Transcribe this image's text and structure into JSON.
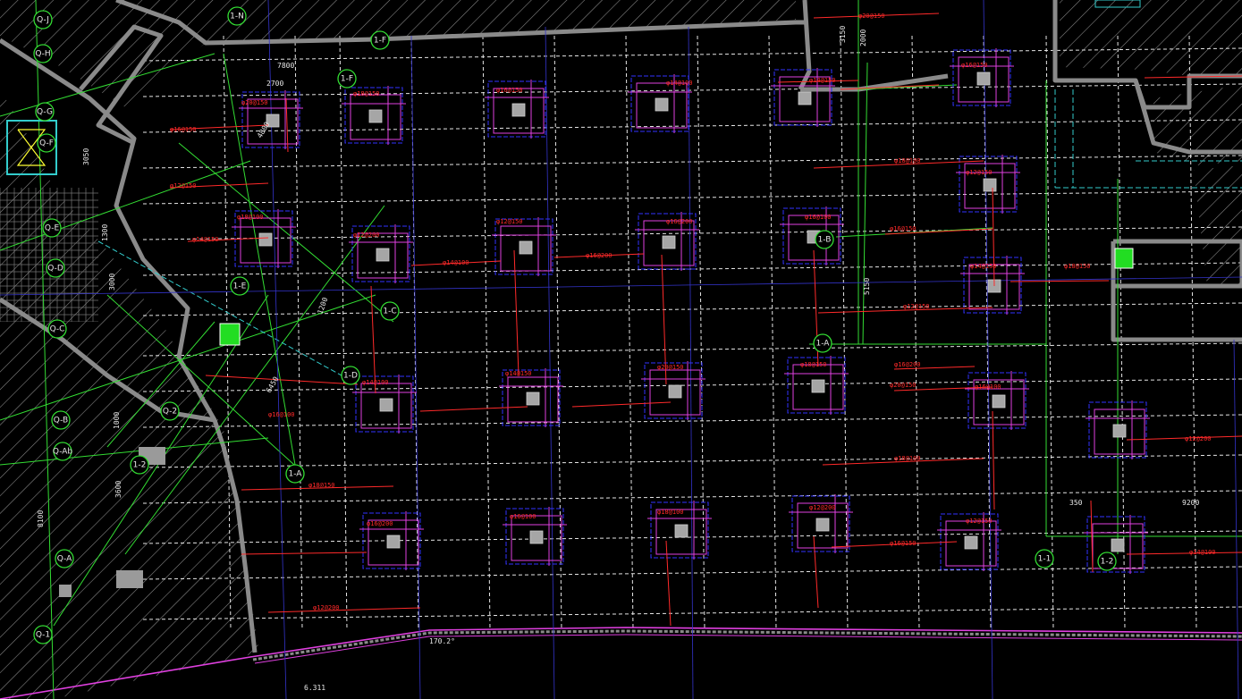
{
  "colors": {
    "background": "#000000",
    "grid": "#e6e6e6",
    "wall": "#8a8a8a",
    "hatch": "#9a9a9a",
    "red_rebar": "#ff2a2a",
    "magenta": "#e040e0",
    "blue": "#3232ff",
    "green": "#33dd33",
    "cyan": "#33cccc",
    "yellow": "#ffff33"
  },
  "axis_bubbles": [
    {
      "id": "bubble-1-F2",
      "label": "1-F"
    },
    {
      "id": "bubble-1-E",
      "label": "1-E"
    },
    {
      "id": "bubble-1-C",
      "label": "1-C"
    },
    {
      "id": "bubble-1-D",
      "label": "1-D"
    },
    {
      "id": "bubble-1-A",
      "label": "1-A"
    },
    {
      "id": "bubble-1-B",
      "label": "1-B"
    },
    {
      "id": "bubble-1-Ab",
      "label": "1-A"
    },
    {
      "id": "bubble-1-1",
      "label": "1-1"
    },
    {
      "id": "bubble-1-2",
      "label": "1-2"
    },
    {
      "id": "bubble-1-2b",
      "label": "1-2"
    },
    {
      "id": "bubble-1-N",
      "label": "1-N"
    },
    {
      "id": "bubble-1-F",
      "label": "1-F"
    },
    {
      "id": "bubble-q-J",
      "label": "Q-J"
    },
    {
      "id": "bubble-q-H",
      "label": "Q-H"
    },
    {
      "id": "bubble-q-G",
      "label": "Q-G"
    },
    {
      "id": "bubble-q-F",
      "label": "Q-F"
    },
    {
      "id": "bubble-q-E",
      "label": "Q-E"
    },
    {
      "id": "bubble-q-D",
      "label": "Q-D"
    },
    {
      "id": "bubble-q-C",
      "label": "Q-C"
    },
    {
      "id": "bubble-q-B",
      "label": "Q-B"
    },
    {
      "id": "bubble-q-Ab",
      "label": "Q-Ab"
    },
    {
      "id": "bubble-q-A",
      "label": "Q-A"
    },
    {
      "id": "bubble-q-1",
      "label": "Q-1"
    },
    {
      "id": "bubble-q-2",
      "label": "Q-2"
    }
  ],
  "dimensions": [
    {
      "id": "dim-7800",
      "label": "7800"
    },
    {
      "id": "dim-2700",
      "label": "2700"
    },
    {
      "id": "dim-2000",
      "label": "2000"
    },
    {
      "id": "dim-3150",
      "label": "3150"
    },
    {
      "id": "dim-350",
      "label": "350"
    },
    {
      "id": "dim-9200",
      "label": "9200"
    },
    {
      "id": "dim-5150",
      "label": "5150"
    },
    {
      "id": "dim-4800",
      "label": "4800"
    },
    {
      "id": "dim-3000",
      "label": "3000"
    },
    {
      "id": "dim-1200",
      "label": "1200"
    },
    {
      "id": "dim-6450",
      "label": "6450"
    },
    {
      "id": "dim-1000",
      "label": "1000"
    },
    {
      "id": "dim-3600",
      "label": "3600"
    },
    {
      "id": "dim-8100",
      "label": "8100"
    },
    {
      "id": "dim-3050",
      "label": "3050"
    },
    {
      "id": "dim-1300",
      "label": "1300"
    },
    {
      "id": "dim-170",
      "label": "170.2°"
    },
    {
      "id": "dim-6311",
      "label": "6.311"
    }
  ],
  "rebar_labels": [
    "φ16@150",
    "φ12@150",
    "φ14@150",
    "φ16@100",
    "φ18@150",
    "φ12@200",
    "φ14@100",
    "φ16@200",
    "φ20@150",
    "φ18@100"
  ]
}
